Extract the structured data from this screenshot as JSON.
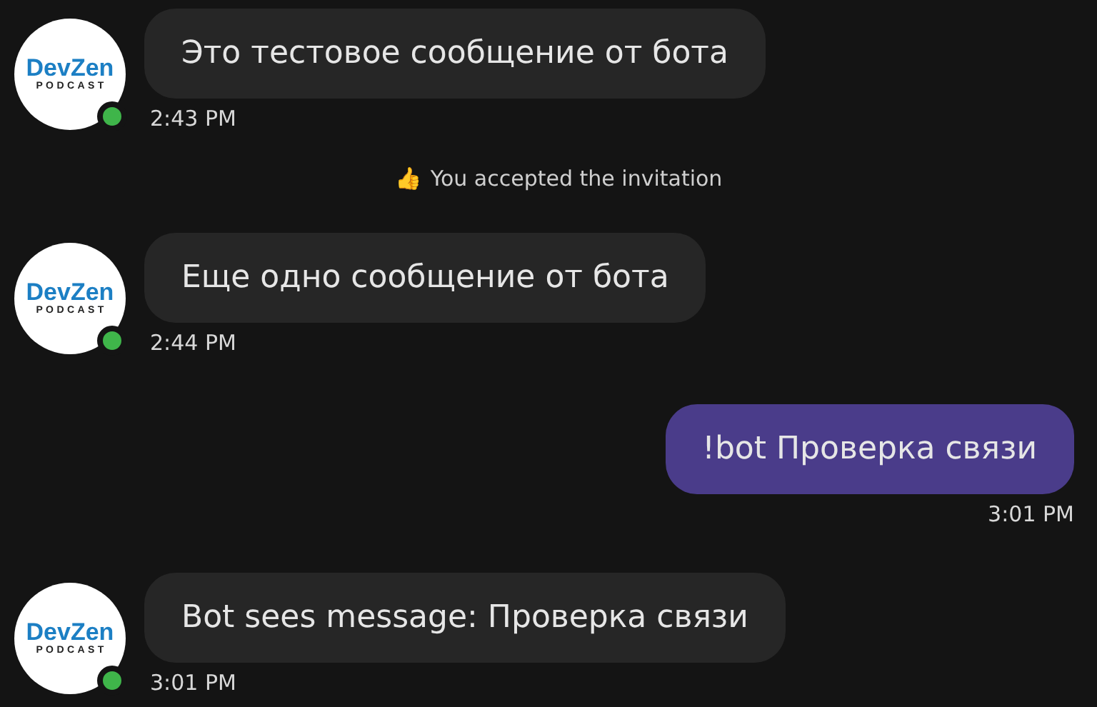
{
  "messages": [
    {
      "kind": "incoming",
      "avatar": {
        "title": "DevZen",
        "subtitle": "PODCAST",
        "online": true
      },
      "text": "Это тестовое сообщение от бота",
      "time": "2:43 PM"
    },
    {
      "kind": "notice",
      "icon": "👍",
      "text": "You accepted the invitation"
    },
    {
      "kind": "incoming",
      "avatar": {
        "title": "DevZen",
        "subtitle": "PODCAST",
        "online": true
      },
      "text": "Еще одно сообщение от бота",
      "time": "2:44 PM"
    },
    {
      "kind": "outgoing",
      "text": "!bot Проверка связи",
      "time": "3:01 PM"
    },
    {
      "kind": "incoming",
      "avatar": {
        "title": "DevZen",
        "subtitle": "PODCAST",
        "online": true
      },
      "text": "Bot sees message: Проверка связи",
      "time": "3:01 PM"
    }
  ]
}
